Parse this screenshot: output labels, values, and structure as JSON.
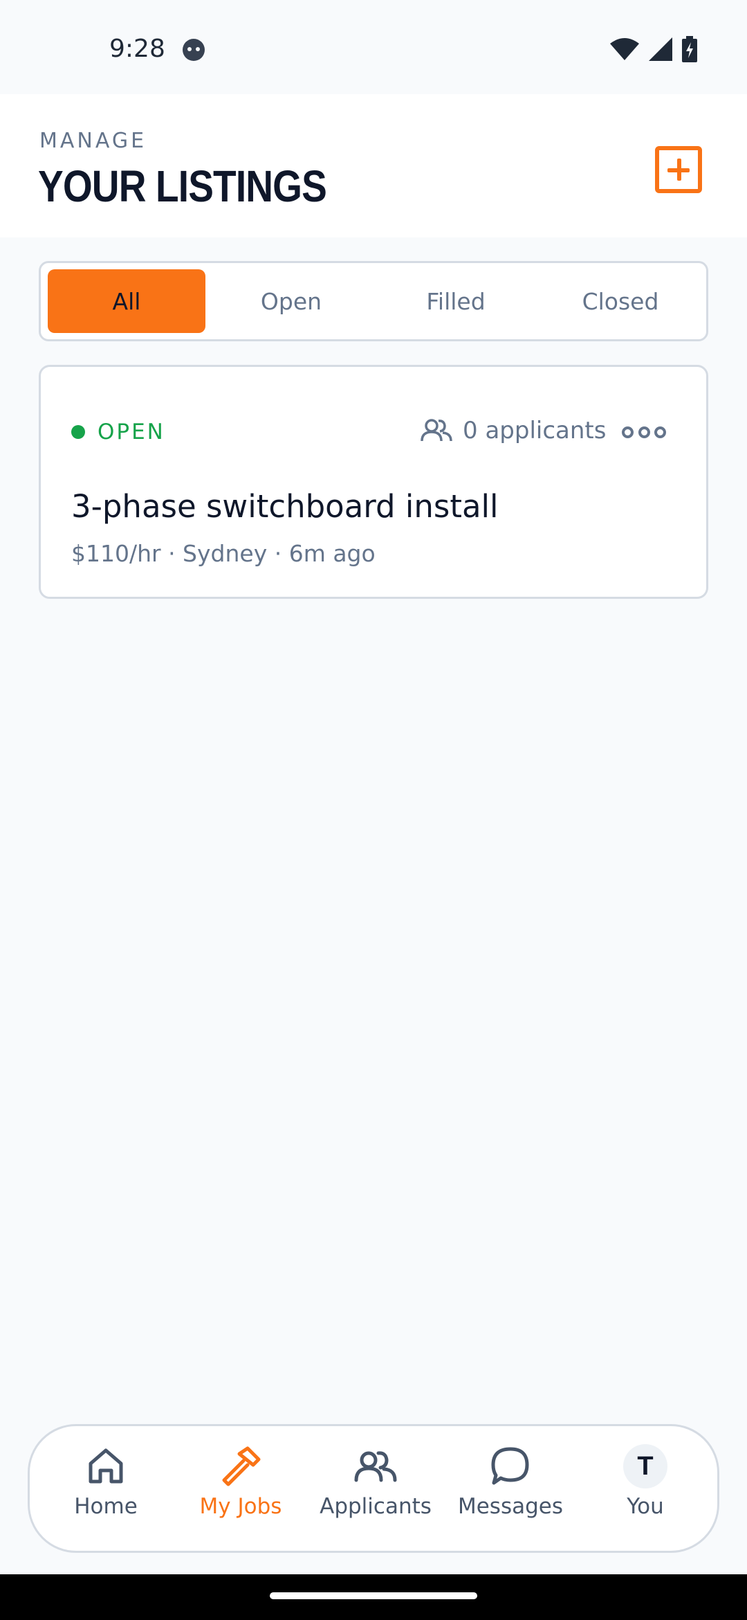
{
  "status_bar": {
    "time": "9:28"
  },
  "header": {
    "kicker": "MANAGE",
    "title": "YOUR LISTINGS"
  },
  "filters": {
    "tabs": [
      {
        "label": "All",
        "active": true
      },
      {
        "label": "Open",
        "active": false
      },
      {
        "label": "Filled",
        "active": false
      },
      {
        "label": "Closed",
        "active": false
      }
    ]
  },
  "listing": {
    "status": "OPEN",
    "applicants": "0 applicants",
    "title": "3-phase switchboard install",
    "meta": "$110/hr · Sydney · 6m ago"
  },
  "bottom_nav": {
    "items": [
      {
        "label": "Home",
        "icon": "home-icon",
        "active": false
      },
      {
        "label": "My Jobs",
        "icon": "hammer-icon",
        "active": true
      },
      {
        "label": "Applicants",
        "icon": "people-icon",
        "active": false
      },
      {
        "label": "Messages",
        "icon": "chat-bubble-icon",
        "active": false
      },
      {
        "label": "You",
        "icon": "avatar",
        "active": false
      }
    ],
    "avatar_initial": "T"
  },
  "colors": {
    "accent": "#f97316",
    "open_status": "#16a34a",
    "muted_text": "#64748b"
  }
}
